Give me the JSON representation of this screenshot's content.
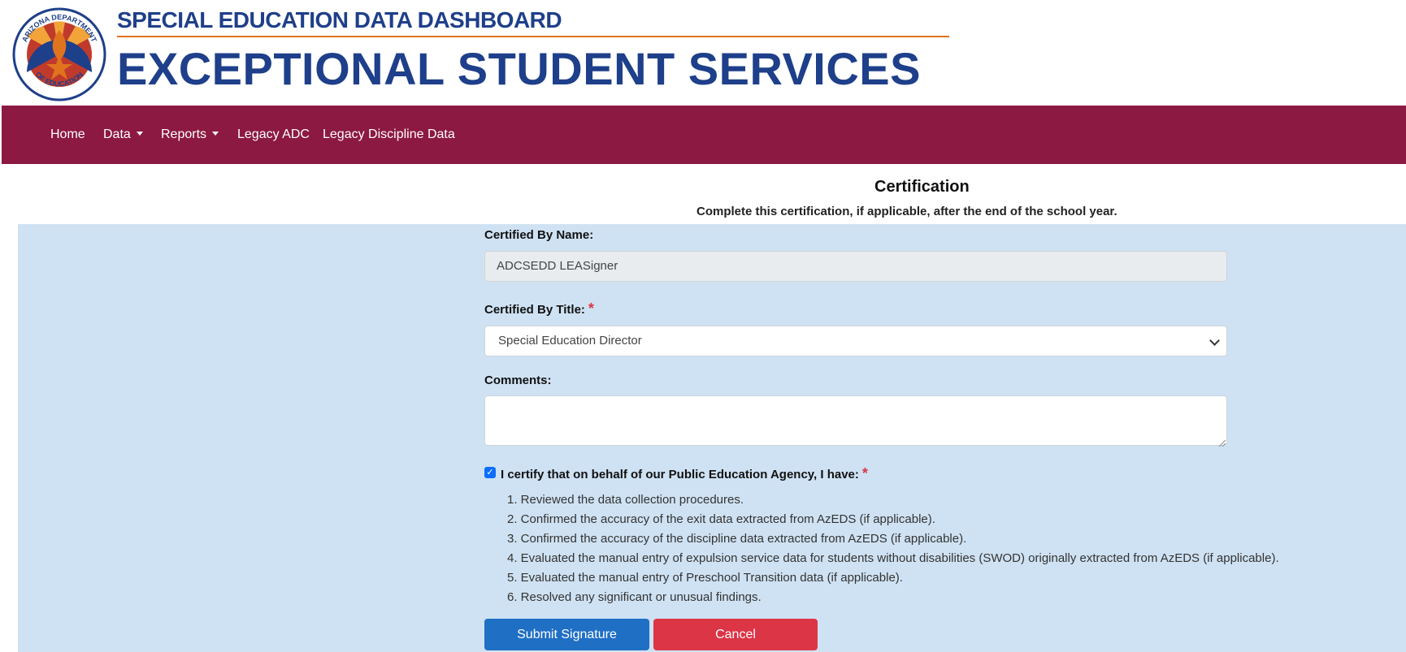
{
  "header": {
    "seal_text_top": "ARIZONA DEPARTMENT",
    "seal_text_bottom": "OF EDUCATION",
    "subtitle": "SPECIAL EDUCATION DATA DASHBOARD",
    "title": "EXCEPTIONAL STUDENT SERVICES"
  },
  "nav": {
    "items": [
      {
        "label": "Home"
      },
      {
        "label": "Data",
        "dropdown": true
      },
      {
        "label": "Reports",
        "dropdown": true
      },
      {
        "label": "Legacy ADC"
      },
      {
        "label": "Legacy Discipline Data"
      }
    ]
  },
  "certification": {
    "heading": "Certification",
    "instructions": "Complete this certification, if applicable, after the end of the school year."
  },
  "form": {
    "name_label": "Certified By Name:",
    "name_value": "ADCSEDD LEASigner",
    "title_label": "Certified By Title:",
    "required_marker": "*",
    "title_value": "Special Education Director",
    "comments_label": "Comments:",
    "comments_value": "",
    "certify_checked": true,
    "certify_label": "I certify that on behalf of our Public Education Agency, I have:",
    "steps": [
      "1. Reviewed the data collection procedures.",
      "2. Confirmed the accuracy of the exit data extracted from AzEDS (if applicable).",
      "3. Confirmed the accuracy of the discipline data extracted from AzEDS (if applicable).",
      "4. Evaluated the manual entry of expulsion service data for students without disabilities (SWOD) originally extracted from AzEDS (if applicable).",
      "5. Evaluated the manual entry of Preschool Transition data (if applicable).",
      "6. Resolved any significant or unusual findings."
    ],
    "submit_label": "Submit Signature",
    "cancel_label": "Cancel"
  },
  "colors": {
    "brand_navy": "#1e3f8a",
    "nav_maroon": "#8c1941",
    "accent_orange": "#e0731e",
    "panel_blue": "#cfe2f3",
    "submit_blue": "#1f6fc5",
    "cancel_red": "#dc3545"
  }
}
